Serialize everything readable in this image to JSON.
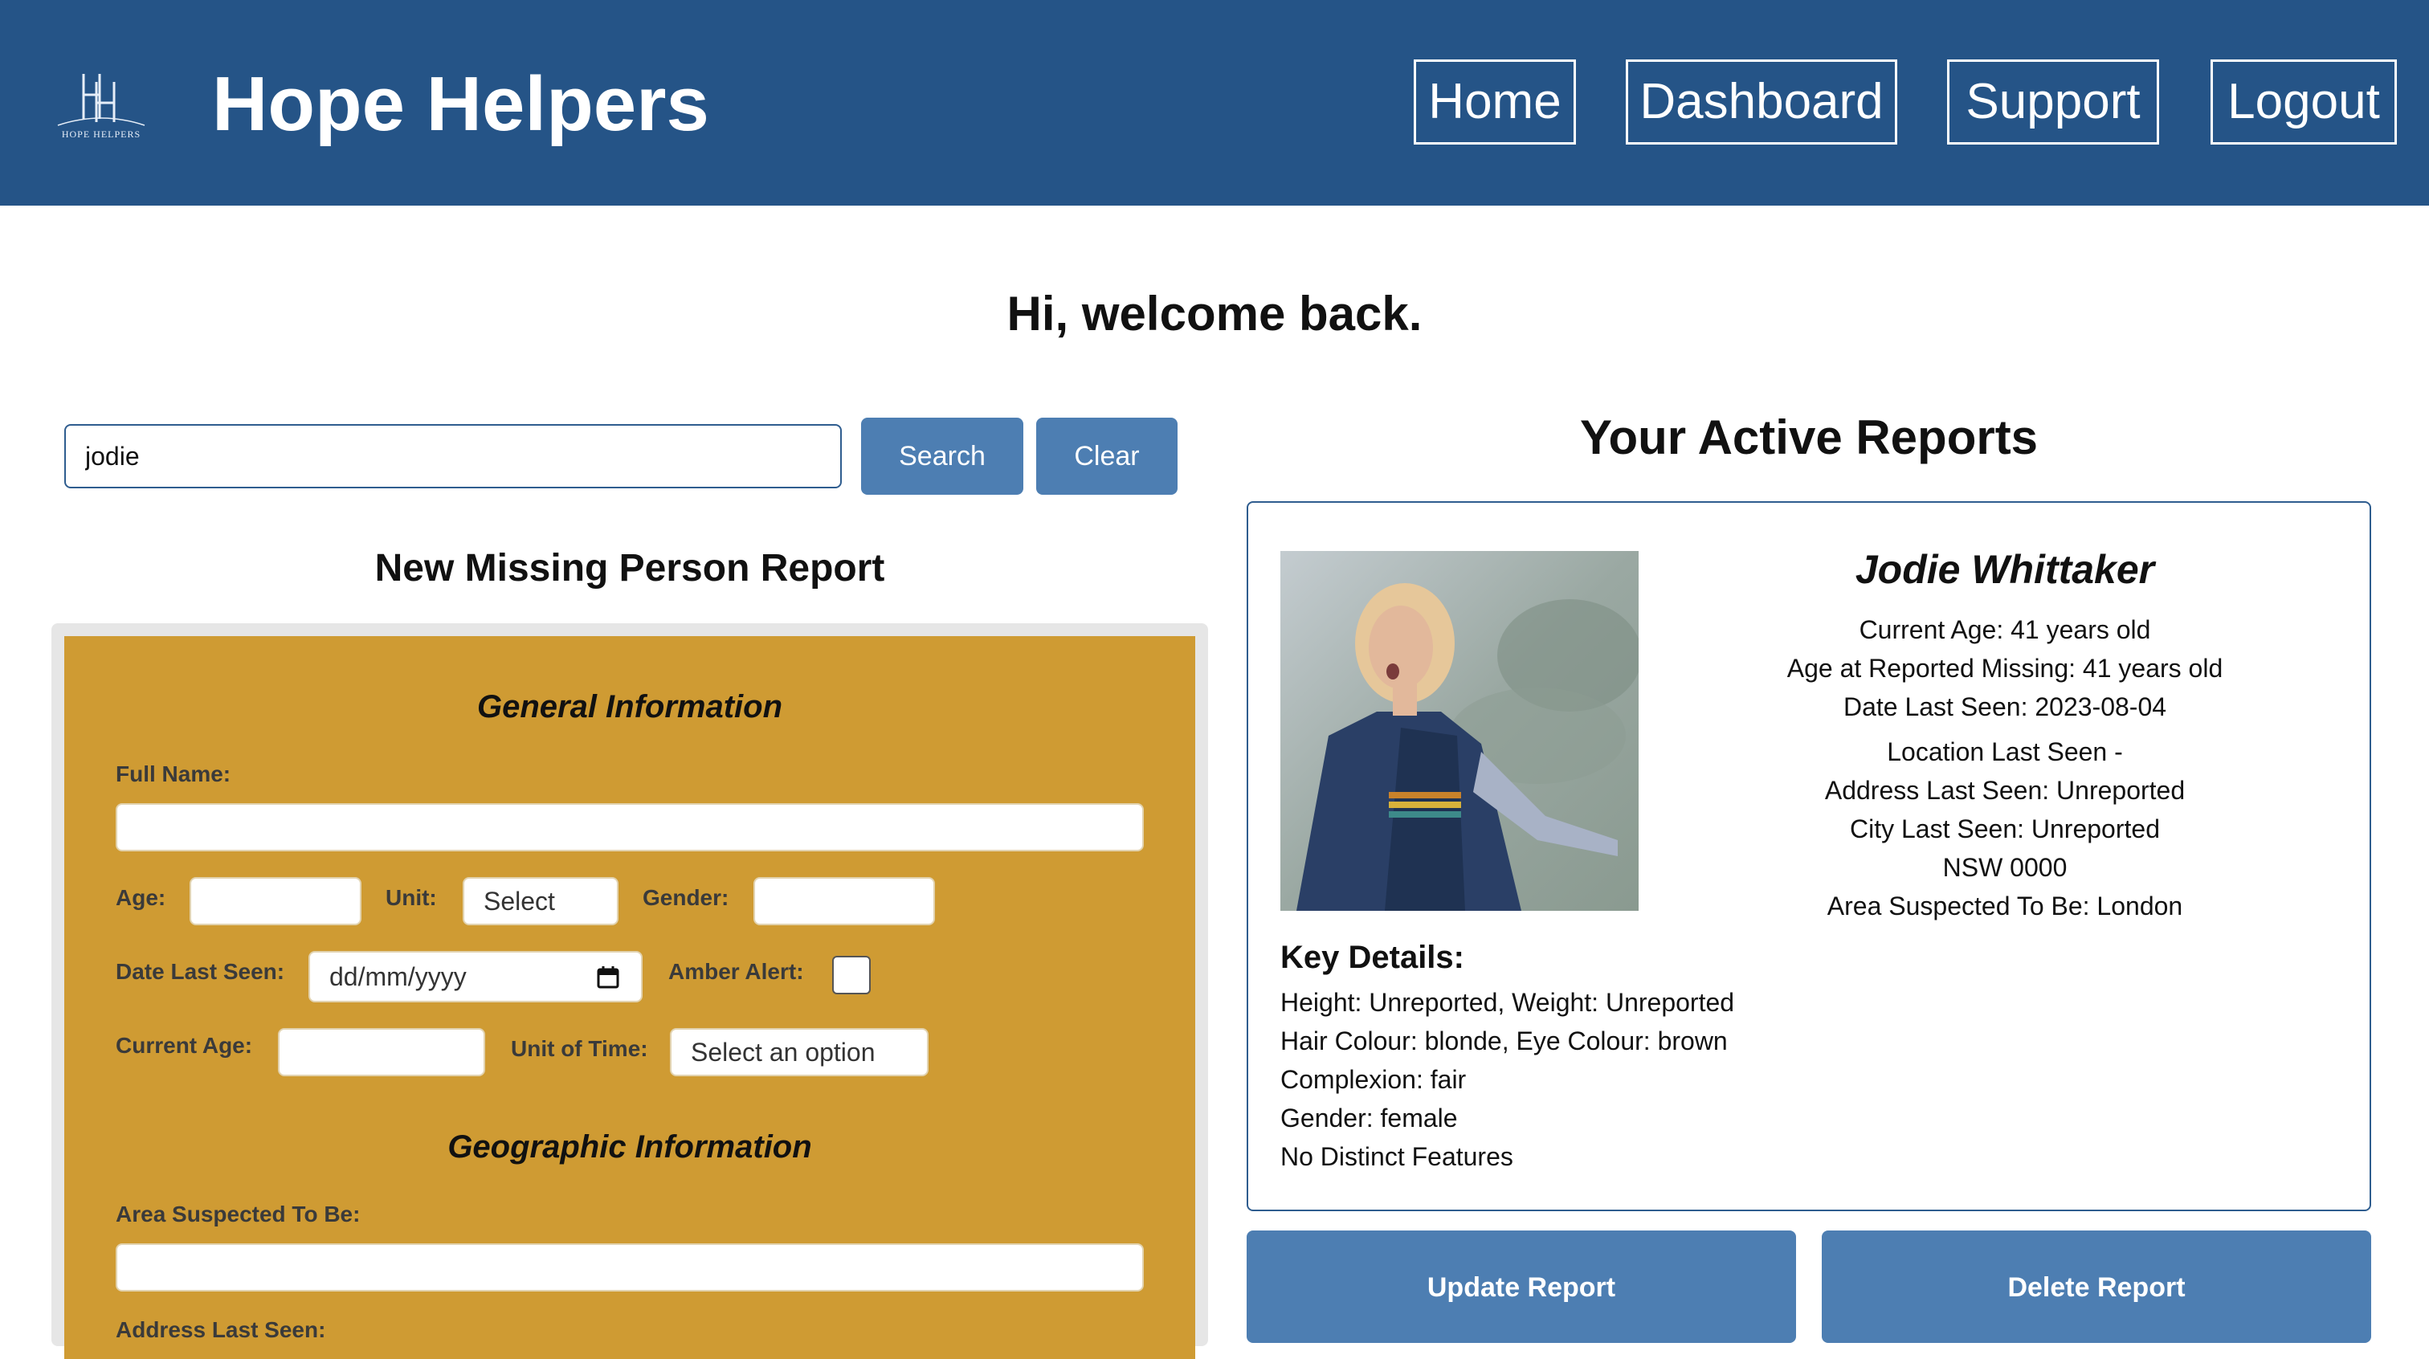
{
  "header": {
    "logo_text": "HOPE HELPERS",
    "brand": "Hope Helpers",
    "nav": [
      "Home",
      "Dashboard",
      "Support",
      "Logout"
    ]
  },
  "welcome": "Hi, welcome back.",
  "search": {
    "value": "jodie",
    "search_label": "Search",
    "clear_label": "Clear"
  },
  "form": {
    "title": "New Missing Person Report",
    "general_title": "General Information",
    "full_name_label": "Full Name:",
    "age_label": "Age:",
    "unit_label": "Unit:",
    "unit_value": "Select",
    "gender_label": "Gender:",
    "date_last_seen_label": "Date Last Seen:",
    "date_placeholder": "dd/mm/yyyy",
    "amber_alert_label": "Amber Alert:",
    "current_age_label": "Current Age:",
    "unit_of_time_label": "Unit of Time:",
    "unit_of_time_value": "Select an option",
    "geo_title": "Geographic Information",
    "area_label": "Area Suspected To Be:",
    "address_label": "Address Last Seen:"
  },
  "reports": {
    "title": "Your Active Reports",
    "card": {
      "name": "Jodie Whittaker",
      "lines": [
        "Current Age: 41 years old",
        "Age at Reported Missing: 41 years old",
        "Date Last Seen: 2023-08-04",
        "Location Last Seen -",
        "Address Last Seen: Unreported",
        "City Last Seen: Unreported",
        "NSW 0000",
        "Area Suspected To Be: London"
      ],
      "key_details_title": "Key Details:",
      "key_details": [
        "Height: Unreported, Weight: Unreported",
        "Hair Colour: blonde, Eye Colour: brown",
        "Complexion: fair",
        "Gender: female",
        "No Distinct Features"
      ]
    },
    "update_label": "Update Report",
    "delete_label": "Delete Report"
  },
  "colors": {
    "header_bg": "#255487",
    "button_blue": "#4d7eb2",
    "form_gold": "#cf9b33"
  }
}
